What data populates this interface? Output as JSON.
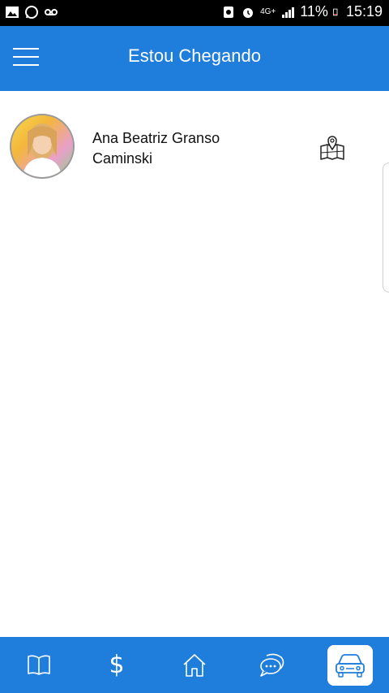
{
  "status_bar": {
    "network": "4G+",
    "battery": "11%",
    "time": "15:19"
  },
  "header": {
    "title": "Estou Chegando"
  },
  "people": [
    {
      "name_line1": "Ana Beatriz Granso",
      "name_line2": "Caminski"
    }
  ],
  "bottom_nav": [
    {
      "icon": "book-icon",
      "active": false
    },
    {
      "icon": "dollar-icon",
      "active": false,
      "glyph": "$"
    },
    {
      "icon": "home-icon",
      "active": false
    },
    {
      "icon": "chat-icon",
      "active": false
    },
    {
      "icon": "car-icon",
      "active": true
    }
  ],
  "colors": {
    "primary": "#1f7edb",
    "icon": "#ffffff",
    "active_icon": "#1f7edb"
  }
}
